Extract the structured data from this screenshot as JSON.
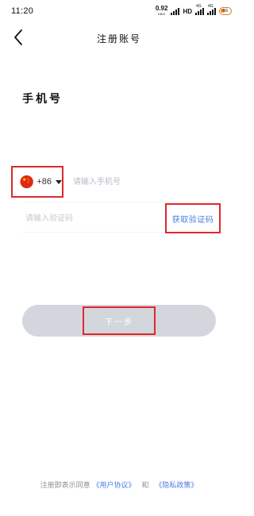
{
  "status_bar": {
    "time": "11:20",
    "net_speed": "0.92",
    "net_unit": "KB/S",
    "hd": "HD",
    "signal_1_label": "4G",
    "signal_2_label": "4G",
    "battery": "59",
    "battery_color": "#e07b1a"
  },
  "nav": {
    "title": "注册账号",
    "back_icon": "chevron-left-icon"
  },
  "page": {
    "title": "手机号"
  },
  "form": {
    "country_flag": "china-flag-icon",
    "country_code": "+86",
    "phone_placeholder": "请输入手机号",
    "code_placeholder": "请输入验证码",
    "get_code_label": "获取验证码",
    "next_label": "下一步"
  },
  "footer": {
    "prefix": "注册即表示同意",
    "user_agreement": "《用户协议》",
    "and": "和",
    "privacy_policy": "《隐私政策》"
  },
  "colors": {
    "accent": "#4a7de0",
    "highlight_border": "#e0272b",
    "button_bg": "#d3d6dd",
    "placeholder": "#b8bcc6"
  }
}
